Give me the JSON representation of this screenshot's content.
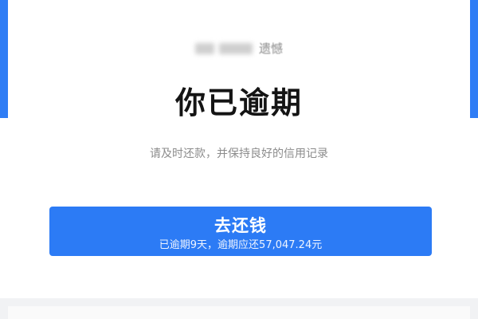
{
  "greeting": {
    "visible_text": "遗憾"
  },
  "status": {
    "title": "你已逾期",
    "subtitle": "请及时还款，并保持良好的信用记录"
  },
  "pay_button": {
    "label": "去还钱",
    "detail": "已逾期9天，逾期应还57,047.24元"
  },
  "colors": {
    "accent": "#2c7bf5",
    "title": "#141414",
    "subtitle": "#8c8c8c"
  }
}
